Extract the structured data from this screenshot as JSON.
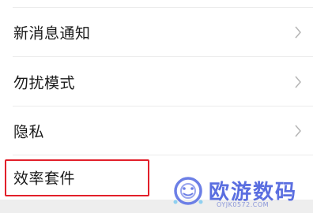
{
  "settings": {
    "items": [
      {
        "label": "新消息通知",
        "icon": "chevron-right-icon"
      },
      {
        "label": "勿扰模式",
        "icon": "chevron-right-icon"
      },
      {
        "label": "隐私",
        "icon": "chevron-right-icon"
      },
      {
        "label": "效率套件"
      }
    ]
  },
  "highlight": {
    "color": "#e21f2a"
  },
  "watermark": {
    "text": "欧游数码",
    "url": "OYJK0572.COM",
    "color": "#5a6ee0"
  }
}
